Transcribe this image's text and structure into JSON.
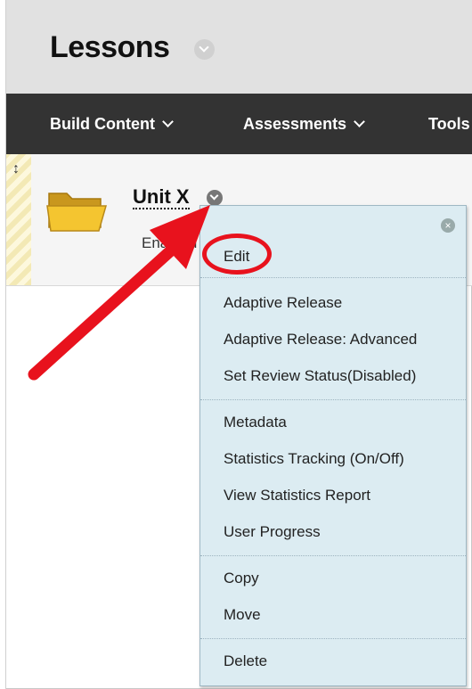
{
  "header": {
    "title": "Lessons"
  },
  "toolbar": {
    "items": [
      {
        "label": "Build Content"
      },
      {
        "label": "Assessments"
      },
      {
        "label": "Tools"
      }
    ]
  },
  "content_item": {
    "title": "Unit X",
    "status": "Enabled"
  },
  "context_menu": {
    "groups": [
      [
        "Edit",
        "Adaptive Release",
        "Adaptive Release: Advanced",
        "Set Review Status(Disabled)"
      ],
      [
        "Metadata",
        "Statistics Tracking (On/Off)",
        "View Statistics Report",
        "User Progress"
      ],
      [
        "Copy",
        "Move"
      ],
      [
        "Delete"
      ]
    ]
  },
  "annotation": {
    "color": "#e8121d"
  }
}
